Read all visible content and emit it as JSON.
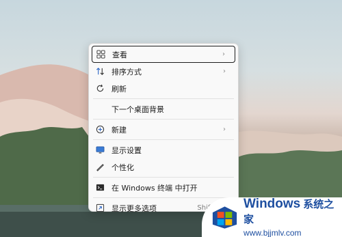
{
  "menu": {
    "items": [
      {
        "label": "查看",
        "icon": "grid-icon",
        "submenu": true
      },
      {
        "label": "排序方式",
        "icon": "sort-icon",
        "submenu": true
      },
      {
        "label": "刷新",
        "icon": "refresh-icon",
        "submenu": false
      },
      {
        "label": "下一个桌面背景",
        "icon": "",
        "submenu": false
      },
      {
        "label": "新建",
        "icon": "plus-circle-icon",
        "submenu": true
      },
      {
        "label": "显示设置",
        "icon": "monitor-icon",
        "submenu": false
      },
      {
        "label": "个性化",
        "icon": "brush-icon",
        "submenu": false
      },
      {
        "label": "在 Windows 终端 中打开",
        "icon": "terminal-icon",
        "submenu": false
      },
      {
        "label": "显示更多选项",
        "icon": "expand-icon",
        "submenu": false,
        "shortcut": "Shift+F10"
      }
    ]
  },
  "watermark": {
    "brand": "Windows",
    "brand_cn": "系统之家",
    "url": "www.bjjmlv.com"
  },
  "colors": {
    "menu_bg": "#f9f9f9",
    "accent": "#1e4fa0"
  }
}
